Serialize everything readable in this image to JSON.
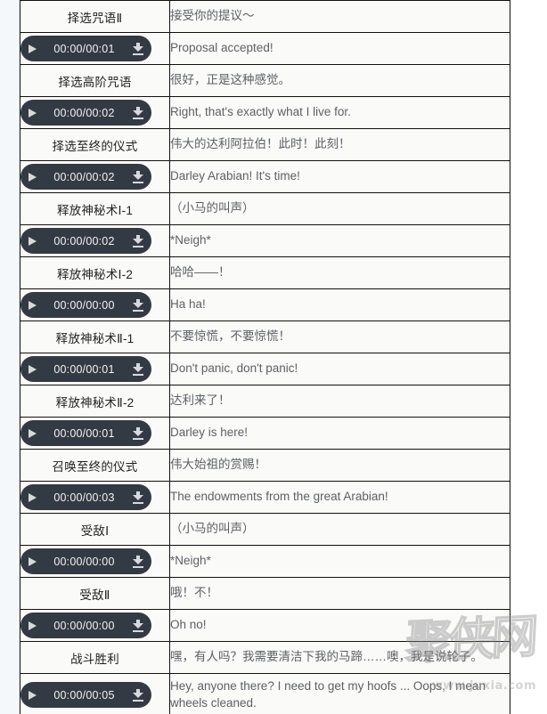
{
  "watermark": {
    "characters": "聚侠网",
    "url": "www.juxia.com"
  },
  "icons": {
    "play": "play-icon",
    "download": "download-icon"
  },
  "table": {
    "rows": [
      {
        "kind": "label",
        "label": "择选咒语Ⅱ",
        "line": "接受你的提议～",
        "lang": "zh"
      },
      {
        "kind": "audio",
        "time": "00:00/00:01",
        "line": "Proposal accepted!",
        "lang": "en"
      },
      {
        "kind": "label",
        "label": "择选高阶咒语",
        "line": "很好，正是这种感觉。",
        "lang": "zh"
      },
      {
        "kind": "audio",
        "time": "00:00/00:02",
        "line": "Right, that's exactly what I live for.",
        "lang": "en"
      },
      {
        "kind": "label",
        "label": "择选至终的仪式",
        "line": "伟大的达利阿拉伯！此时！此刻！",
        "lang": "zh"
      },
      {
        "kind": "audio",
        "time": "00:00/00:02",
        "line": "Darley Arabian! It's time!",
        "lang": "en"
      },
      {
        "kind": "label",
        "label": "释放神秘术Ⅰ-1",
        "line": "（小马的叫声）",
        "lang": "zh"
      },
      {
        "kind": "audio",
        "time": "00:00/00:02",
        "line": "*Neigh*",
        "lang": "en"
      },
      {
        "kind": "label",
        "label": "释放神秘术Ⅰ-2",
        "line": "哈哈——！",
        "lang": "zh"
      },
      {
        "kind": "audio",
        "time": "00:00/00:00",
        "line": "Ha ha!",
        "lang": "en"
      },
      {
        "kind": "label",
        "label": "释放神秘术Ⅱ-1",
        "line": "不要惊慌，不要惊慌！",
        "lang": "zh"
      },
      {
        "kind": "audio",
        "time": "00:00/00:01",
        "line": "Don't panic, don't panic!",
        "lang": "en"
      },
      {
        "kind": "label",
        "label": "释放神秘术Ⅱ-2",
        "line": "达利来了！",
        "lang": "zh"
      },
      {
        "kind": "audio",
        "time": "00:00/00:01",
        "line": "Darley is here!",
        "lang": "en"
      },
      {
        "kind": "label",
        "label": "召唤至终的仪式",
        "line": "伟大始祖的赏赐！",
        "lang": "zh"
      },
      {
        "kind": "audio",
        "time": "00:00/00:03",
        "line": "The endowments from the great Arabian!",
        "lang": "en"
      },
      {
        "kind": "label",
        "label": "受敌Ⅰ",
        "line": "（小马的叫声）",
        "lang": "zh"
      },
      {
        "kind": "audio",
        "time": "00:00/00:00",
        "line": "*Neigh*",
        "lang": "en"
      },
      {
        "kind": "label",
        "label": "受敌Ⅱ",
        "line": "哦！不！",
        "lang": "zh"
      },
      {
        "kind": "audio",
        "time": "00:00/00:00",
        "line": "Oh no!",
        "lang": "en"
      },
      {
        "kind": "label",
        "label": "战斗胜利",
        "line": "嘿，有人吗？我需要清洁下我的马蹄……噢，我是说轮子。",
        "lang": "zh"
      },
      {
        "kind": "audio",
        "time": "00:00/00:05",
        "line": "Hey, anyone there? I need to get my hoofs ... Oops, I mean wheels cleaned.",
        "lang": "en",
        "tall": true
      }
    ]
  }
}
